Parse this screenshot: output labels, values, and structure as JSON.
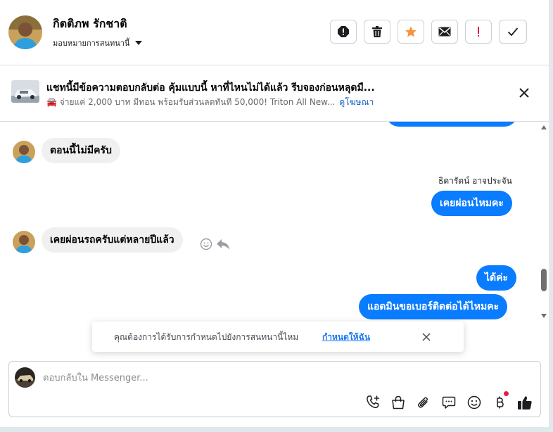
{
  "header": {
    "contact_name": "กิตติภพ รักชาติ",
    "assign_label": "มอบหมายการสนทนานี้",
    "toolbar": [
      {
        "name": "spam-button",
        "icon": "alert-circle-icon"
      },
      {
        "name": "delete-button",
        "icon": "trash-icon"
      },
      {
        "name": "star-button",
        "icon": "star-icon"
      },
      {
        "name": "mark-unread-button",
        "icon": "envelope-icon"
      },
      {
        "name": "follow-up-button",
        "icon": "exclamation-icon"
      },
      {
        "name": "mark-done-button",
        "icon": "check-icon"
      }
    ]
  },
  "ad": {
    "title": "แชทนี้มีข้อความตอบกลับต่อ คุ้มแบบนี้ หาที่ไหนไม่ได้แล้ว รีบจองก่อนหลุดมื...",
    "subtitle": "🚘 จ่ายแค่ 2,000 บาท มีทอน พร้อมรับส่วนลดทันที 50,000! Triton All New...",
    "link": "ดูโฆษณา"
  },
  "messages": [
    {
      "from": "contact",
      "text": "ตอนนี้ไม่มีครับ"
    },
    {
      "from": "page",
      "sender": "ธิดารัตน์ อาจประจัน",
      "text": "เคยผ่อนไหมคะ"
    },
    {
      "from": "contact",
      "text": "เคยผ่อนรถครับแต่หลายปีแล้ว"
    },
    {
      "from": "page",
      "text": "ได้ค่ะ"
    },
    {
      "from": "page",
      "text": "แอดมินขอเบอร์ติดต่อได้ไหมคะ"
    }
  ],
  "notice": {
    "text": "คุณต้องการได้รับการกำหนดไปยังการสนทนานี้ไหม",
    "link": "กำหนดให้ฉัน"
  },
  "composer": {
    "placeholder": "ตอบกลับใน Messenger...",
    "icons": [
      "call-add-icon",
      "shopping-bag-icon",
      "paperclip-icon",
      "saved-reply-icon",
      "emoji-icon",
      "baht-payment-icon",
      "thumbs-up-icon"
    ]
  },
  "colors": {
    "accent_blue": "#0a7cff",
    "star_orange": "#f7923b",
    "follow_up_red": "#e41e3f",
    "incoming_bubble": "#f0f0f0"
  }
}
